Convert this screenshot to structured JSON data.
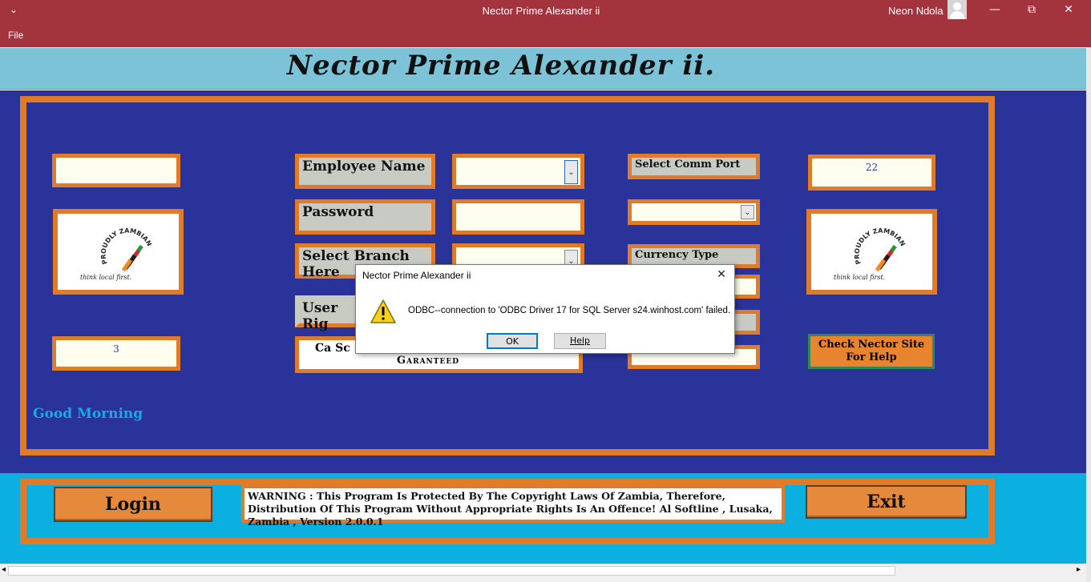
{
  "window": {
    "title": "Nector Prime Alexander ii",
    "user": "Neon Ndola",
    "menu_glyph": "⩡",
    "minimize": "—",
    "restore": "⧉",
    "close": "✕"
  },
  "menu": {
    "file": "File"
  },
  "app_title": "Nector Prime Alexander ii.",
  "form": {
    "top_left_value": "",
    "employee_label": "Employee Name",
    "password_label": "Password",
    "branch_label": "Select Branch Here",
    "user_rights_label": "User Rig",
    "comm_port_label": "Select Comm Port",
    "currency_label": "Currency Type",
    "port_value": "22",
    "counter_value": "3",
    "ca_text": "Ca Sc",
    "guaranteed_text": "Garanteed",
    "greeting": "Good Morning",
    "help_button": "Check Nector Site For Help"
  },
  "logo": {
    "arc_text": "PROUDLY ZAMBIAN",
    "tagline": "think local first."
  },
  "bottom": {
    "login": "Login",
    "exit": "Exit",
    "warning": "WARNING : This Program Is Protected By The Copyright Laws Of Zambia, Therefore, Distribution Of This Program Without Appropriate Rights Is An Offence! Al Softline , Lusaka, Zambia , Version 2.0.0.1"
  },
  "dialog": {
    "title": "Nector Prime Alexander ii",
    "message": "ODBC--connection to 'ODBC Driver 17 for SQL Server s24.winhost.com' failed.",
    "ok": "OK",
    "help": "Help",
    "close": "✕",
    "icon": "warning-icon"
  },
  "colors": {
    "titlebar": "#a3333d",
    "panel": "#29339a",
    "frame": "#e07b2a",
    "header": "#7cc3d8",
    "bottom": "#0cb0e0",
    "greeting": "#19a9e8"
  }
}
